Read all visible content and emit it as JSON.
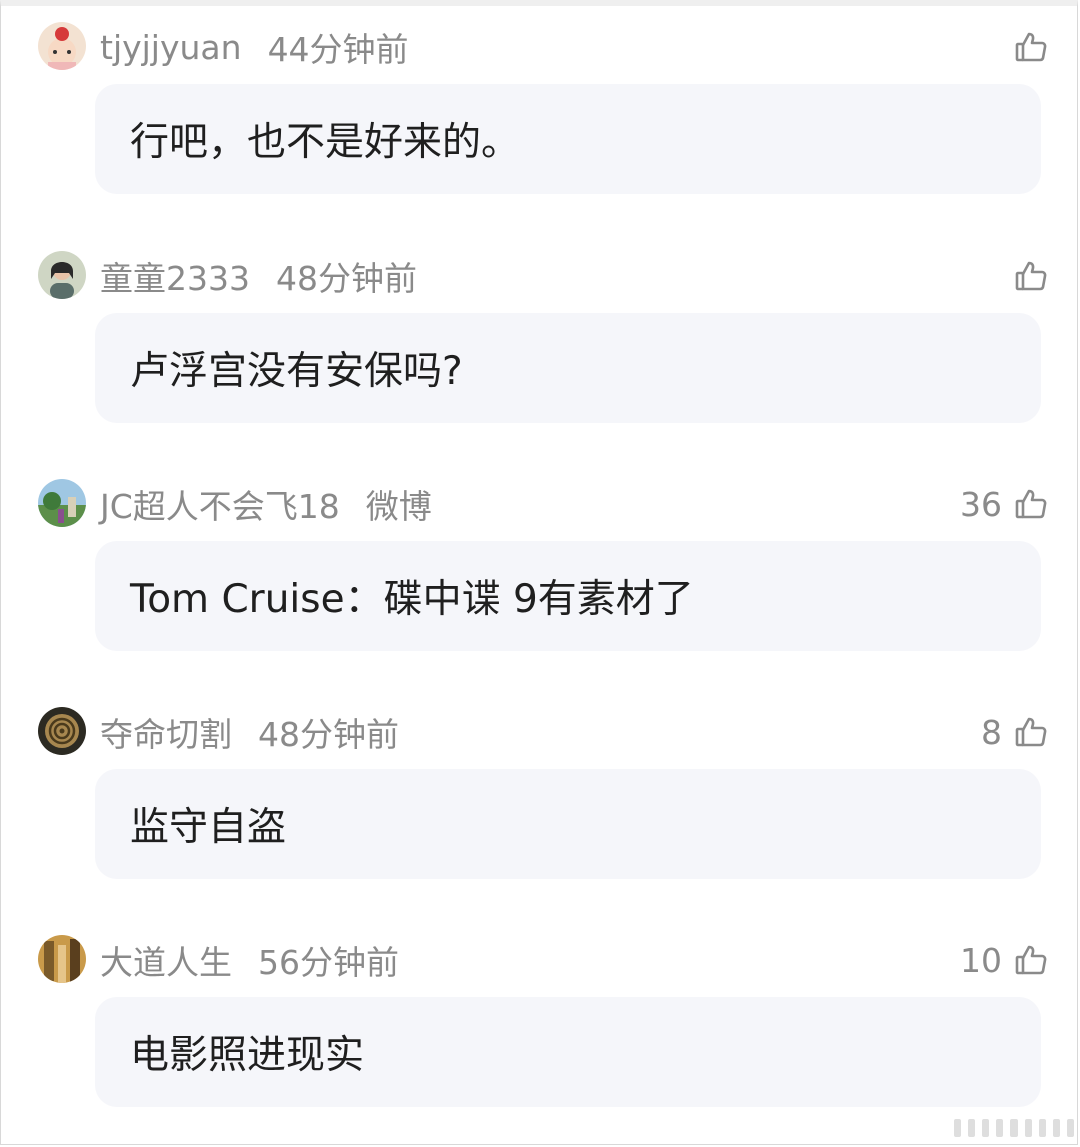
{
  "comments": [
    {
      "username": "tjyjjyuan",
      "time": "44分钟前",
      "likes": "",
      "text": "行吧，也不是好来的。",
      "avatar": "avatar-girl-red-flower"
    },
    {
      "username": "童童2333",
      "time": "48分钟前",
      "likes": "",
      "text": "卢浮宫没有安保吗?",
      "avatar": "avatar-woman-portrait"
    },
    {
      "username": "JC超人不会飞18",
      "time": "微博",
      "likes": "36",
      "text": "Tom Cruise：碟中谍 9有素材了",
      "avatar": "avatar-landscape-scene"
    },
    {
      "username": "夺命切割",
      "time": "48分钟前",
      "likes": "8",
      "text": "监守自盗",
      "avatar": "avatar-spiral-roll"
    },
    {
      "username": "大道人生",
      "time": "56分钟前",
      "likes": "10",
      "text": "电影照进现实",
      "avatar": "avatar-painting"
    }
  ],
  "icons": {
    "like": "thumbs-up-icon"
  },
  "colors": {
    "meta_text": "#8a8a8a",
    "bubble_bg": "#f5f6fa",
    "body_text": "#1f1f1f"
  }
}
